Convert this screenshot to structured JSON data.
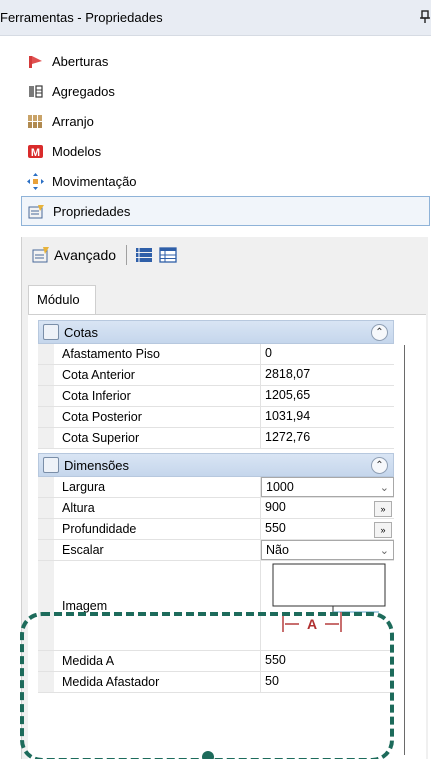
{
  "window": {
    "title": "Ferramentas - Propriedades"
  },
  "tools": [
    {
      "label": "Aberturas",
      "icon": "aberturas-icon"
    },
    {
      "label": "Agregados",
      "icon": "agregados-icon"
    },
    {
      "label": "Arranjo",
      "icon": "arranjo-icon"
    },
    {
      "label": "Modelos",
      "icon": "modelos-icon"
    },
    {
      "label": "Movimentação",
      "icon": "movimentacao-icon"
    },
    {
      "label": "Propriedades",
      "icon": "propriedades-icon"
    }
  ],
  "panel": {
    "toolbar_label": "Avançado",
    "tab_label": "Módulo"
  },
  "cotas": {
    "title": "Cotas",
    "rows": [
      {
        "name": "Afastamento Piso",
        "value": "0"
      },
      {
        "name": "Cota Anterior",
        "value": "2818,07"
      },
      {
        "name": "Cota Inferior",
        "value": "1205,65"
      },
      {
        "name": "Cota Posterior",
        "value": "1031,94"
      },
      {
        "name": "Cota Superior",
        "value": "1272,76"
      }
    ]
  },
  "dimensoes": {
    "title": "Dimensões",
    "largura": {
      "name": "Largura",
      "value": "1000"
    },
    "altura": {
      "name": "Altura",
      "value": "900"
    },
    "profundidade": {
      "name": "Profundidade",
      "value": "550"
    },
    "escalar": {
      "name": "Escalar",
      "value": "Não"
    },
    "imagem": {
      "name": "Imagem",
      "dimension_label": "A"
    },
    "medida_a": {
      "name": "Medida A",
      "value": "550"
    },
    "medida_afastador": {
      "name": "Medida Afastador",
      "value": "50"
    }
  },
  "colors": {
    "accent_dash": "#1d6b5b",
    "category_header": "#c5d6ec",
    "selection_border": "#8fb3d8"
  }
}
